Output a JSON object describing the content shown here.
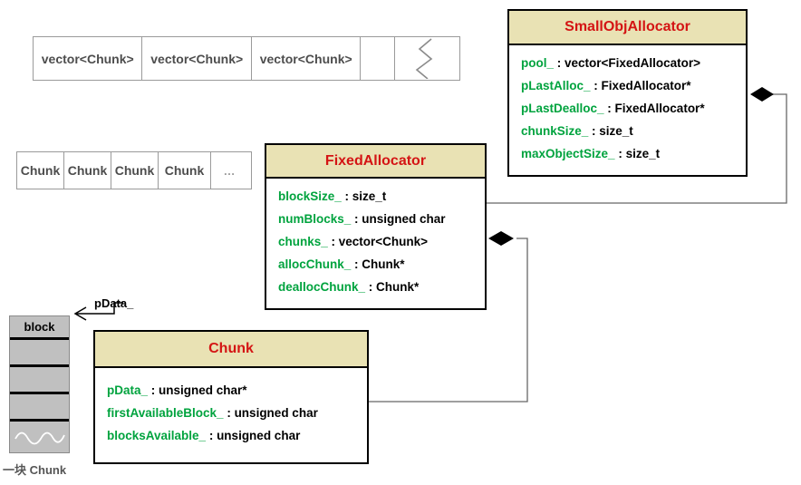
{
  "diagram": {
    "title": "SmallObjAllocator memory pool class diagram",
    "colors": {
      "header_fill": "#e9e2b4",
      "class_name": "#d41414",
      "member_name": "#00a33e",
      "member_type": "#000000",
      "cell_text": "#4d4d4d",
      "memory_fill": "#c0c0c0",
      "connector": "#555555",
      "box_border": "#000000"
    },
    "classes": [
      {
        "id": "small-obj-allocator",
        "name": "SmallObjAllocator",
        "members": [
          {
            "name": "pool_",
            "type": "vector<FixedAllocator>"
          },
          {
            "name": "pLastAlloc_",
            "type": "FixedAllocator*"
          },
          {
            "name": "pLastDealloc_",
            "type": "FixedAllocator*"
          },
          {
            "name": "chunkSize_",
            "type": "size_t"
          },
          {
            "name": "maxObjectSize_",
            "type": "size_t"
          }
        ]
      },
      {
        "id": "fixed-allocator",
        "name": "FixedAllocator",
        "members": [
          {
            "name": "blockSize_",
            "type": "size_t"
          },
          {
            "name": "numBlocks_",
            "type": "unsigned char"
          },
          {
            "name": "chunks_",
            "type": "vector<Chunk>"
          },
          {
            "name": "allocChunk_",
            "type": "Chunk*"
          },
          {
            "name": "deallocChunk_",
            "type": "Chunk*"
          }
        ]
      },
      {
        "id": "chunk",
        "name": "Chunk",
        "members": [
          {
            "name": "pData_",
            "type": "unsigned char*"
          },
          {
            "name": "firstAvailableBlock_",
            "type": "unsigned char"
          },
          {
            "name": "blocksAvailable_",
            "type": "unsigned char"
          }
        ]
      }
    ],
    "vector_array": {
      "cells": [
        "vector<Chunk>",
        "vector<Chunk>",
        "vector<Chunk>",
        "",
        ""
      ],
      "break_marker": "zigzag-break-icon"
    },
    "chunk_array": {
      "cells": [
        "Chunk",
        "Chunk",
        "Chunk",
        "Chunk"
      ],
      "ellipsis": "…",
      "ellipsis_icon": "ellipsis-icon"
    },
    "memory_column": {
      "first_cell_label": "block",
      "empty_cells": 3,
      "wave_marker": "wave-break-icon",
      "caption": "一块 Chunk"
    },
    "annotations": [
      {
        "id": "pdata-pointer",
        "label": "pData_",
        "arrow": "arrow-left-icon"
      }
    ],
    "connectors": [
      {
        "id": "smallobj-to-fixed",
        "from": "SmallObjAllocator",
        "to": "FixedAllocator",
        "kind": "composition",
        "marker": "filled-diamond-icon"
      },
      {
        "id": "fixed-to-chunk",
        "from": "FixedAllocator",
        "to": "Chunk",
        "kind": "composition",
        "marker": "filled-diamond-icon"
      }
    ]
  }
}
